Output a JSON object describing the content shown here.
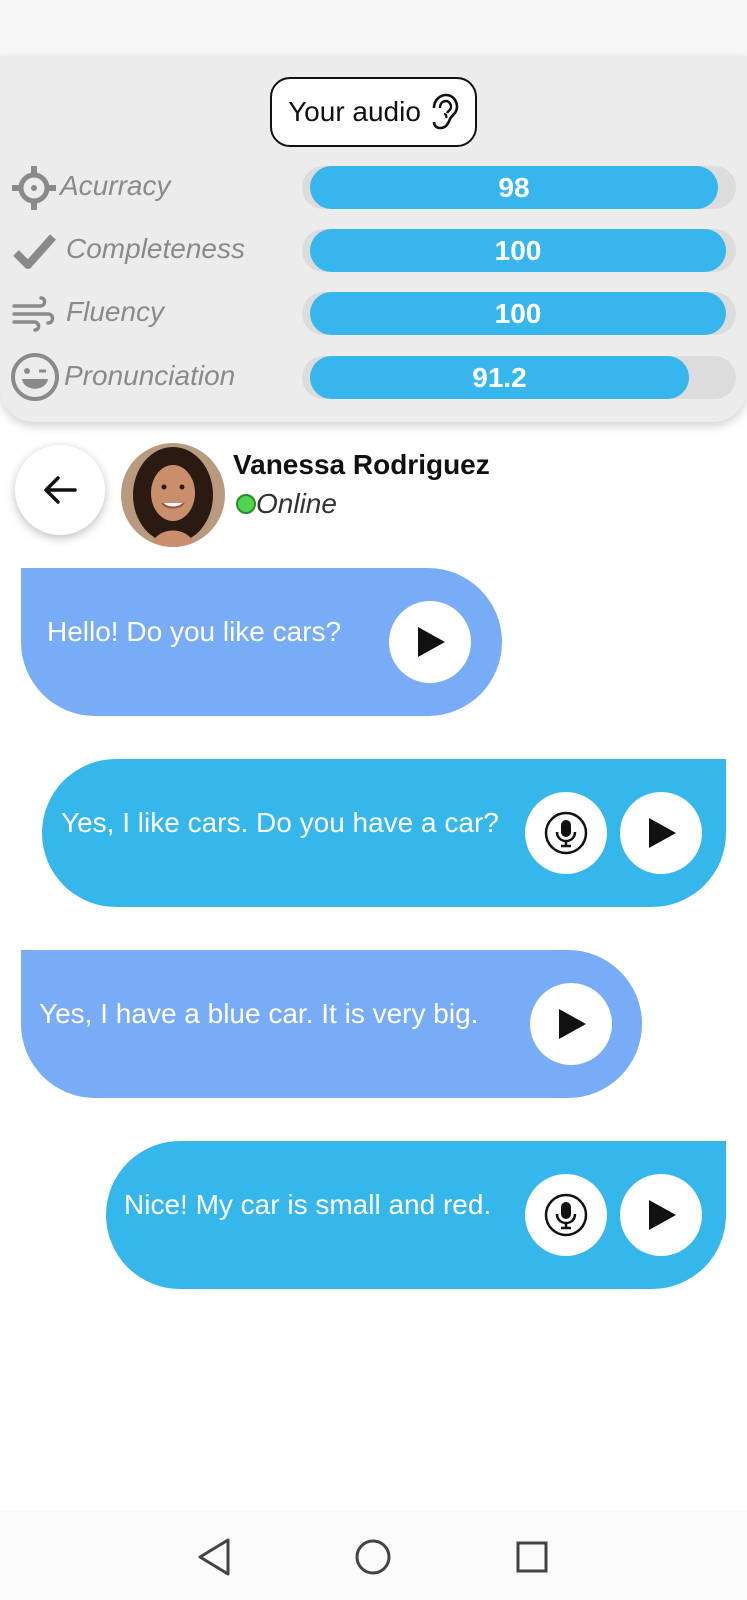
{
  "audio_button": {
    "label": "Your audio",
    "icon": "ear-icon"
  },
  "metrics": [
    {
      "label": "Acurracy",
      "value": "98",
      "fraction": 0.98,
      "icon": "crosshair-icon"
    },
    {
      "label": "Completeness",
      "value": "100",
      "fraction": 1.0,
      "icon": "check-icon"
    },
    {
      "label": "Fluency",
      "value": "100",
      "fraction": 1.0,
      "icon": "wind-icon"
    },
    {
      "label": "Pronunciation",
      "value": "91.2",
      "fraction": 0.912,
      "icon": "smiley-icon"
    }
  ],
  "contact": {
    "name": "Vanessa Rodriguez",
    "status": "Online"
  },
  "messages": [
    {
      "sender": "incoming",
      "text": "Hello! Do you like cars?"
    },
    {
      "sender": "outgoing",
      "text": "Yes, I like cars. Do you have a car?"
    },
    {
      "sender": "incoming",
      "text": "Yes, I have a blue car. It is very big."
    },
    {
      "sender": "outgoing",
      "text": "Nice! My car is small and red."
    }
  ],
  "colors": {
    "metric_fill": "#36b6ec",
    "incoming_bubble": "#79acf6",
    "outgoing_bubble": "#35b7ec",
    "online": "#4fd44f"
  }
}
